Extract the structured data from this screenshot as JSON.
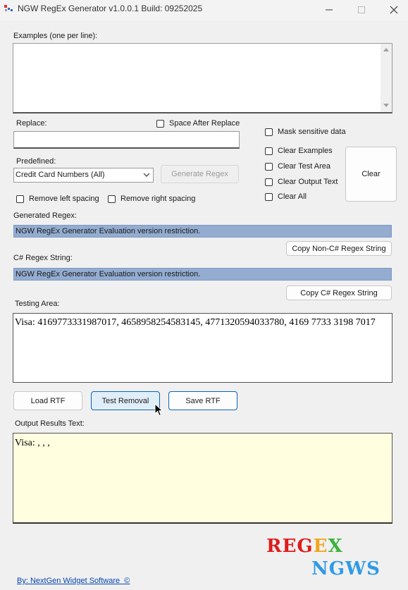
{
  "window": {
    "title": "NGW RegEx Generator v1.0.0.1 Build: 09252025",
    "minimize": "—",
    "maximize": "☐",
    "close": "✕"
  },
  "examples": {
    "label": "Examples (one per line):",
    "value": ""
  },
  "replace": {
    "label": "Replace:",
    "value": "",
    "space_after_label": "Space After Replace"
  },
  "options": {
    "mask_label": "Mask sensitive data",
    "clear_examples": "Clear Examples",
    "clear_test_area": "Clear Test Area",
    "clear_output_text": "Clear Output Text",
    "clear_all": "Clear All",
    "clear_button": "Clear"
  },
  "predefined": {
    "label": "Predefined:",
    "selected": "Credit Card Numbers (All)",
    "generate_button": "Generate Regex"
  },
  "spacing": {
    "remove_left": "Remove left spacing",
    "remove_right": "Remove right spacing"
  },
  "generated": {
    "label": "Generated Regex:",
    "value": "NGW RegEx Generator Evaluation version restriction.",
    "copy_button": "Copy Non-C# Regex String"
  },
  "csharp": {
    "label": "C# Regex String:",
    "value": "NGW RegEx Generator Evaluation version restriction.",
    "copy_button": "Copy C# Regex String"
  },
  "testing": {
    "label": "Testing Area:",
    "text": "Visa: 4169773331987017, 4658958254583145, 4771320594033780, 4169 7733 3198 7017"
  },
  "actions": {
    "load": "Load RTF",
    "test": "Test Removal",
    "save": "Save RTF"
  },
  "output": {
    "label": "Output Results Text:",
    "text": "Visa: , , ,"
  },
  "footer": {
    "link": "By: NextGen Widget Software",
    "copyright": "©",
    "logo_line1": "REGEX",
    "logo_line2": "NGWS"
  },
  "colors": {
    "highlight": "#93acd0",
    "output_bg": "#ffffe0",
    "link": "#0645ad",
    "accent": "#0a64b8"
  }
}
